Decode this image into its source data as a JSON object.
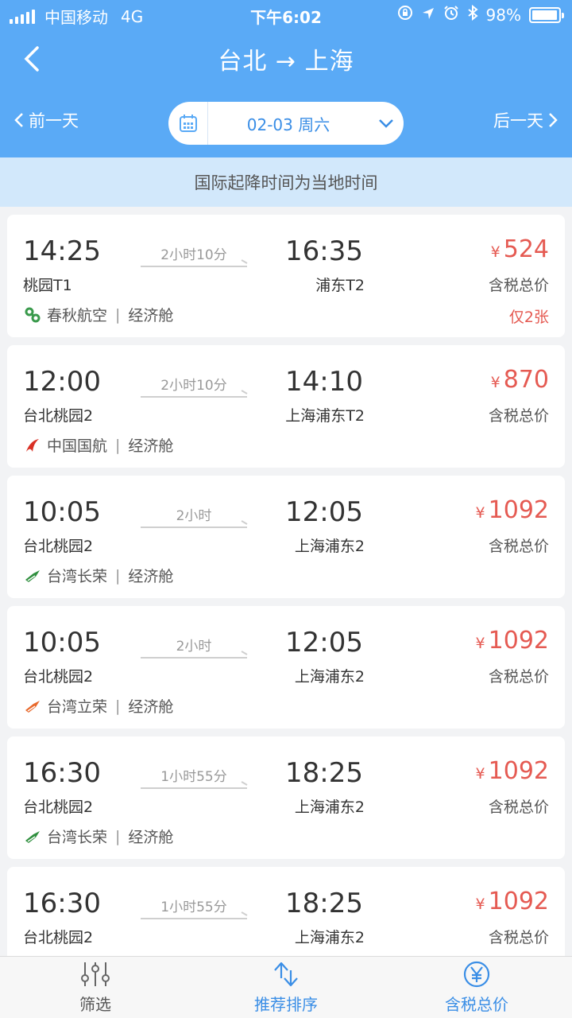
{
  "status": {
    "carrier": "中国移动",
    "network": "4G",
    "time": "下午6:02",
    "battery": "98%",
    "battery_level": 0.98
  },
  "header": {
    "title": "台北 → 上海",
    "prev_day": "前一天",
    "next_day": "后一天",
    "date": "02-03 周六"
  },
  "notice": "国际起降时间为当地时间",
  "flights": [
    {
      "dep_time": "14:25",
      "dep_airport": "桃园T1",
      "duration": "2小时10分",
      "arr_time": "16:35",
      "arr_airport": "浦东T2",
      "currency": "¥",
      "price": "524",
      "tax_label": "含税总价",
      "airline": "春秋航空",
      "cabin": "经济舱",
      "remaining": "仅2张",
      "logo_color": "#3a9a4c"
    },
    {
      "dep_time": "12:00",
      "dep_airport": "台北桃园2",
      "duration": "2小时10分",
      "arr_time": "14:10",
      "arr_airport": "上海浦东T2",
      "currency": "¥",
      "price": "870",
      "tax_label": "含税总价",
      "airline": "中国国航",
      "cabin": "经济舱",
      "remaining": "",
      "logo_color": "#d93025"
    },
    {
      "dep_time": "10:05",
      "dep_airport": "台北桃园2",
      "duration": "2小时",
      "arr_time": "12:05",
      "arr_airport": "上海浦东2",
      "currency": "¥",
      "price": "1092",
      "tax_label": "含税总价",
      "airline": "台湾长荣",
      "cabin": "经济舱",
      "remaining": "",
      "logo_color": "#2f8f3e"
    },
    {
      "dep_time": "10:05",
      "dep_airport": "台北桃园2",
      "duration": "2小时",
      "arr_time": "12:05",
      "arr_airport": "上海浦东2",
      "currency": "¥",
      "price": "1092",
      "tax_label": "含税总价",
      "airline": "台湾立荣",
      "cabin": "经济舱",
      "remaining": "",
      "logo_color": "#e8682a"
    },
    {
      "dep_time": "16:30",
      "dep_airport": "台北桃园2",
      "duration": "1小时55分",
      "arr_time": "18:25",
      "arr_airport": "上海浦东2",
      "currency": "¥",
      "price": "1092",
      "tax_label": "含税总价",
      "airline": "台湾长荣",
      "cabin": "经济舱",
      "remaining": "",
      "logo_color": "#2f8f3e"
    },
    {
      "dep_time": "16:30",
      "dep_airport": "台北桃园2",
      "duration": "1小时55分",
      "arr_time": "18:25",
      "arr_airport": "上海浦东2",
      "currency": "¥",
      "price": "1092",
      "tax_label": "含税总价",
      "airline": "",
      "cabin": "",
      "remaining": "",
      "logo_color": "#2f8f3e"
    }
  ],
  "bottom_nav": [
    {
      "label": "筛选",
      "icon": "filter-icon",
      "active": false
    },
    {
      "label": "推荐排序",
      "icon": "sort-icon",
      "active": true
    },
    {
      "label": "含税总价",
      "icon": "yen-icon",
      "active": true
    }
  ],
  "colors": {
    "header_bg": "#5aaaf6",
    "price": "#e55a52",
    "accent": "#3a8ee6",
    "notice_bg": "#d2e8fb"
  }
}
